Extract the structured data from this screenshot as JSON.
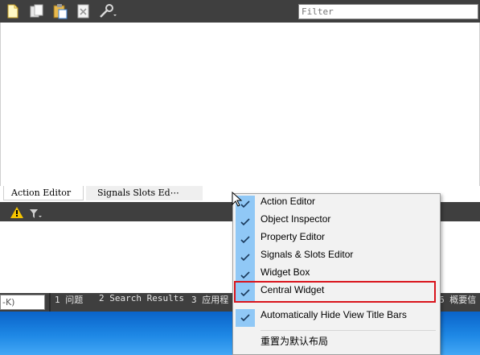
{
  "toolbar": {
    "icons": [
      "new-action-icon",
      "copy-icon",
      "paste-icon",
      "delete-icon",
      "settings-wrench-icon"
    ],
    "filter_placeholder": "Filter"
  },
  "tabs": {
    "action_editor": "Action Editor",
    "signals_slots": "Signals  Slots Ed⋯"
  },
  "issues": {
    "icons": [
      "warning-icon",
      "filter-icon"
    ]
  },
  "status": {
    "locator_value": "-K)",
    "panes": [
      "1  问题",
      "2  Search Results",
      "3  应用程",
      "6  概要信"
    ]
  },
  "menu": {
    "items": [
      {
        "label": "Action Editor",
        "checked": true
      },
      {
        "label": "Object Inspector",
        "checked": true
      },
      {
        "label": "Property Editor",
        "checked": true
      },
      {
        "label": "Signals & Slots Editor",
        "checked": true
      },
      {
        "label": "Widget Box",
        "checked": true
      },
      {
        "label": "Central Widget",
        "checked": true
      },
      {
        "label": "Automatically Hide View Title Bars",
        "checked": true
      },
      {
        "label": "重置为默认布局",
        "checked": false
      }
    ]
  },
  "colors": {
    "toolbar_bg": "#3f3f3f",
    "menu_bg": "#f2f2f2",
    "check_bg": "#90c8f6",
    "highlight": "#d9141c",
    "desktop": "#1e88e5"
  }
}
